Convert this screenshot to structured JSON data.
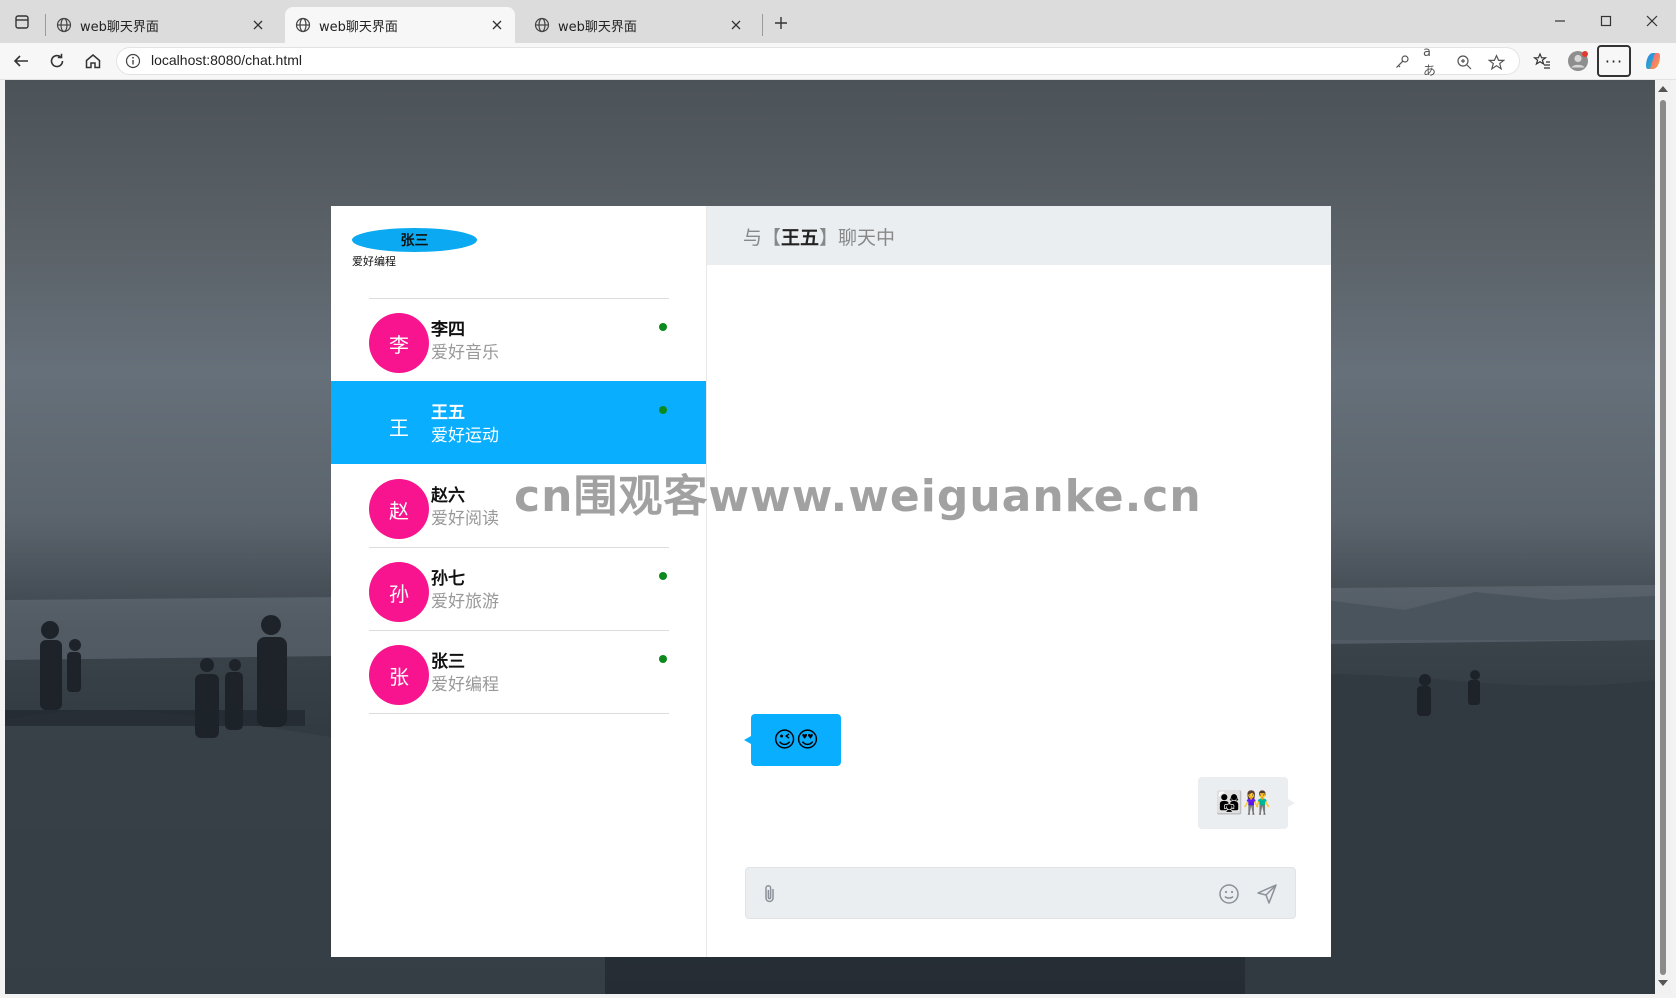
{
  "browser": {
    "tabs": [
      {
        "title": "web聊天界面",
        "active": false
      },
      {
        "title": "web聊天界面",
        "active": true
      },
      {
        "title": "web聊天界面",
        "active": false
      }
    ],
    "url": "localhost:8080/chat.html",
    "read_aloud_label": "aあ"
  },
  "colors": {
    "accent_blue": "#0aaeff",
    "avatar_pink": "#f7148e",
    "online_green": "#0c8a1e",
    "header_gray": "#eaeef1"
  },
  "me": {
    "name": "张三",
    "hobby": "爱好编程"
  },
  "friends": [
    {
      "avatar": "李",
      "name": "李四",
      "hobby": "爱好音乐",
      "online": true,
      "active": false
    },
    {
      "avatar": "王",
      "name": "王五",
      "hobby": "爱好运动",
      "online": true,
      "active": true
    },
    {
      "avatar": "赵",
      "name": "赵六",
      "hobby": "爱好阅读",
      "online": false,
      "active": false
    },
    {
      "avatar": "孙",
      "name": "孙七",
      "hobby": "爱好旅游",
      "online": true,
      "active": false
    },
    {
      "avatar": "张",
      "name": "张三",
      "hobby": "爱好编程",
      "online": true,
      "active": false
    }
  ],
  "chat": {
    "header_prefix": "与【",
    "header_name": "王五",
    "header_suffix": "】聊天中",
    "messages": [
      {
        "direction": "received",
        "content": "😉😍"
      },
      {
        "direction": "sent",
        "content": "👨‍👩‍👧👫"
      }
    ],
    "input_value": "",
    "icons": [
      "paperclip-icon",
      "smile-icon",
      "send-icon"
    ]
  },
  "watermark": "cn围观客www.weiguanke.cn"
}
